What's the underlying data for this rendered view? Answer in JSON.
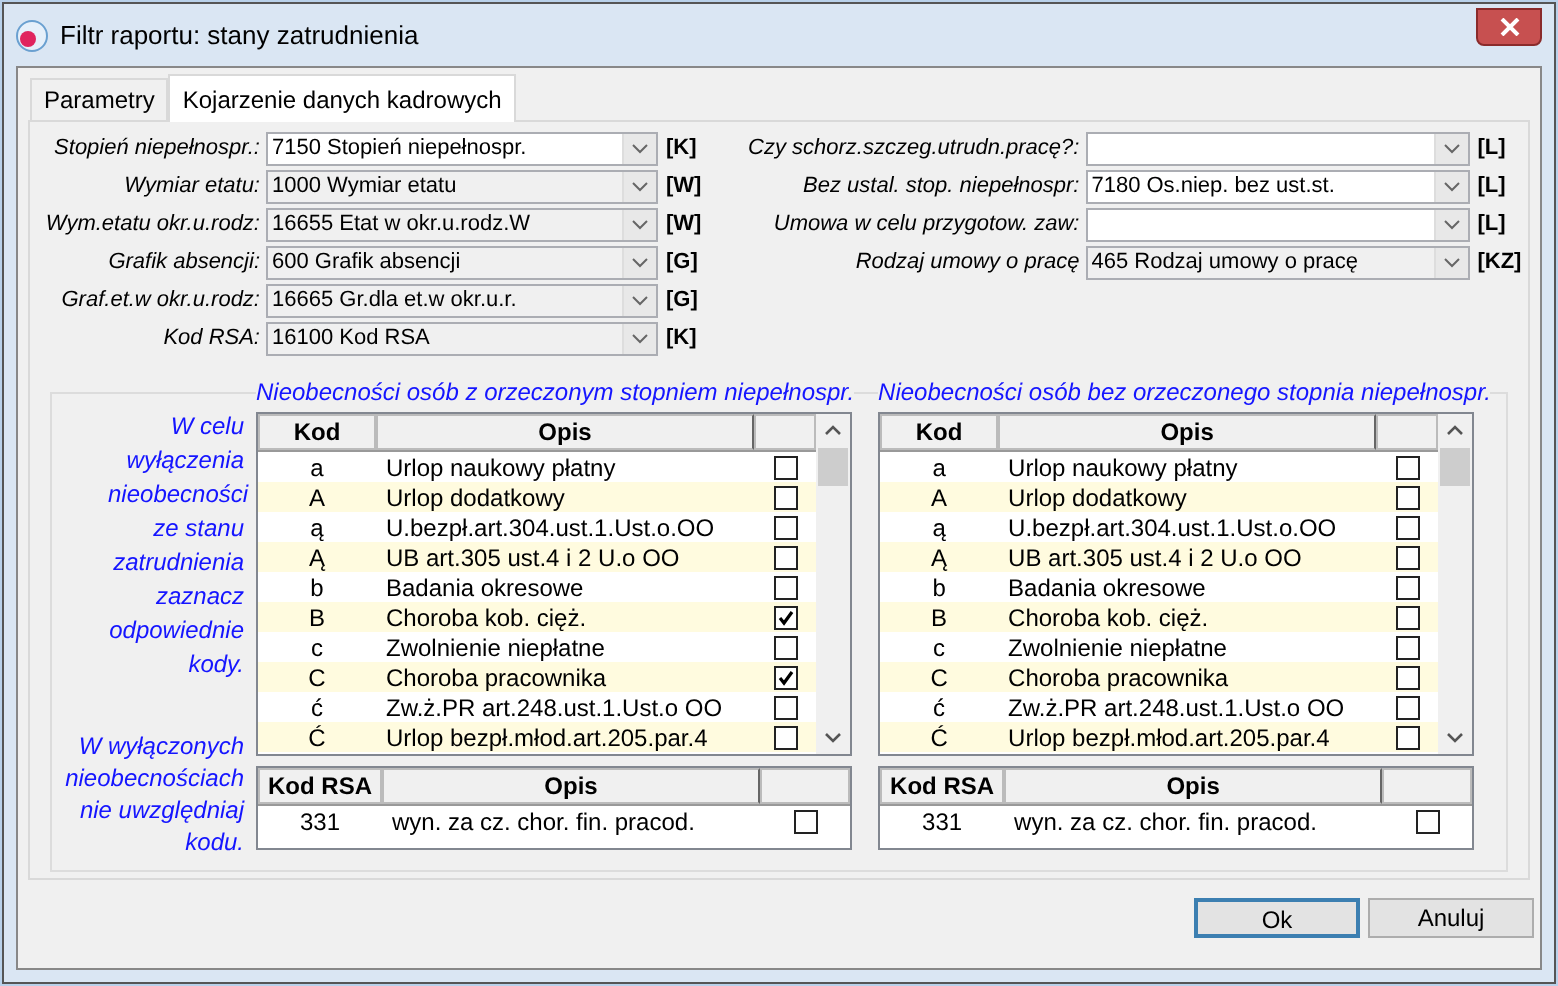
{
  "window": {
    "title": "Filtr raportu: stany zatrudnienia"
  },
  "tabs": [
    {
      "label": "Parametry",
      "selected": false
    },
    {
      "label": "Kojarzenie danych kadrowych",
      "selected": true
    }
  ],
  "fields_left": [
    {
      "label": "Stopień niepełnospr.:",
      "value": "7150 Stopień niepełnospr.",
      "tag": "[K]",
      "editable": true
    },
    {
      "label": "Wymiar etatu:",
      "value": "1000 Wymiar etatu",
      "tag": "[W]",
      "editable": false
    },
    {
      "label": "Wym.etatu okr.u.rodz:",
      "value": "16655 Etat w okr.u.rodz.W",
      "tag": "[W]",
      "editable": false
    },
    {
      "label": "Grafik absencji:",
      "value": "600 Grafik absencji",
      "tag": "[G]",
      "editable": false
    },
    {
      "label": "Graf.et.w okr.u.rodz:",
      "value": "16665 Gr.dla et.w okr.u.r.",
      "tag": "[G]",
      "editable": false
    },
    {
      "label": "Kod RSA:",
      "value": "16100 Kod RSA",
      "tag": "[K]",
      "editable": false
    }
  ],
  "fields_right": [
    {
      "label": "Czy schorz.szczeg.utrudn.pracę?:",
      "tag": "[L]",
      "editable": true
    },
    {
      "label": "Bez ustal. stop. niepełnospr:",
      "value": "7180 Os.niep. bez ust.st.",
      "tag": "[L]",
      "editable": true
    },
    {
      "label": "Umowa w celu przygotow. zaw:",
      "tag": "[L]",
      "editable": true
    },
    {
      "label": "Rodzaj umowy o pracę",
      "value": "465 Rodzaj umowy o pracę",
      "tag": "[KZ]",
      "editable": false
    }
  ],
  "hint_top": "W celu wyłączenia nieobecności ze stanu zatrudnienia zaznacz odpowiednie kody.",
  "hint_bottom": "W wyłączonych nieobecnościach nie uwzględniaj kodu.",
  "panels": [
    {
      "title": "Nieobecności osób z orzeczonym stopniem niepełnospr.",
      "columns": [
        "Kod",
        "Opis"
      ],
      "rows": [
        {
          "code": "a",
          "desc": "Urlop naukowy płatny",
          "checked": false
        },
        {
          "code": "A",
          "desc": "Urlop dodatkowy",
          "checked": false
        },
        {
          "code": "ą",
          "desc": "U.bezpł.art.304.ust.1.Ust.o.OO",
          "checked": false
        },
        {
          "code": "Ą",
          "desc": "UB art.305 ust.4 i 2 U.o OO",
          "checked": false
        },
        {
          "code": "b",
          "desc": "Badania okresowe",
          "checked": false
        },
        {
          "code": "B",
          "desc": "Choroba kob. cięż.",
          "checked": true
        },
        {
          "code": "c",
          "desc": "Zwolnienie niepłatne",
          "checked": false
        },
        {
          "code": "C",
          "desc": "Choroba pracownika",
          "checked": true
        },
        {
          "code": "ć",
          "desc": "Zw.ż.PR art.248.ust.1.Ust.o OO",
          "checked": false
        },
        {
          "code": "Ć",
          "desc": "Urlop bezpł.młod.art.205.par.4",
          "checked": false
        }
      ],
      "rsa_columns": [
        "Kod RSA",
        "Opis"
      ],
      "rsa_rows": [
        {
          "code": "331",
          "desc": "wyn. za cz. chor. fin. pracod.",
          "checked": false
        }
      ]
    },
    {
      "title": "Nieobecności osób bez orzeczonego stopnia niepełnospr.",
      "columns": [
        "Kod",
        "Opis"
      ],
      "rows": [
        {
          "code": "a",
          "desc": "Urlop naukowy płatny",
          "checked": false
        },
        {
          "code": "A",
          "desc": "Urlop dodatkowy",
          "checked": false
        },
        {
          "code": "ą",
          "desc": "U.bezpł.art.304.ust.1.Ust.o.OO",
          "checked": false
        },
        {
          "code": "Ą",
          "desc": "UB art.305 ust.4 i 2 U.o OO",
          "checked": false
        },
        {
          "code": "b",
          "desc": "Badania okresowe",
          "checked": false
        },
        {
          "code": "B",
          "desc": "Choroba kob. cięż.",
          "checked": false
        },
        {
          "code": "c",
          "desc": "Zwolnienie niepłatne",
          "checked": false
        },
        {
          "code": "C",
          "desc": "Choroba pracownika",
          "checked": false
        },
        {
          "code": "ć",
          "desc": "Zw.ż.PR art.248.ust.1.Ust.o OO",
          "checked": false
        },
        {
          "code": "Ć",
          "desc": "Urlop bezpł.młod.art.205.par.4",
          "checked": false
        }
      ],
      "rsa_columns": [
        "Kod RSA",
        "Opis"
      ],
      "rsa_rows": [
        {
          "code": "331",
          "desc": "wyn. za cz. chor. fin. pracod.",
          "checked": false
        }
      ]
    }
  ],
  "buttons": [
    {
      "label": "Ok",
      "default": true
    },
    {
      "label": "Anuluj",
      "default": false
    }
  ]
}
